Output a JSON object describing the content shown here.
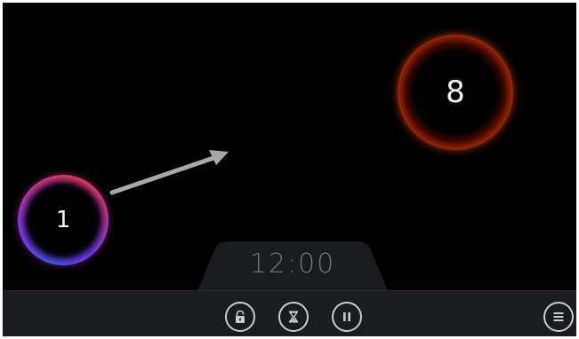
{
  "game": {
    "orbs": [
      {
        "number": "1",
        "color": "#8a3cc0"
      },
      {
        "number": "8",
        "color": "#ff4a10"
      }
    ],
    "timer": "12:00"
  },
  "controls": {
    "lock_icon": "lock-icon",
    "hourglass_icon": "hourglass-icon",
    "pause_icon": "pause-icon",
    "menu_icon": "menu-icon"
  },
  "colors": {
    "background": "#000000",
    "bar": "#1a1c20",
    "timer_text": "#6e7480",
    "arrow": "#a9a9a9",
    "icon": "#c9ccd2"
  }
}
